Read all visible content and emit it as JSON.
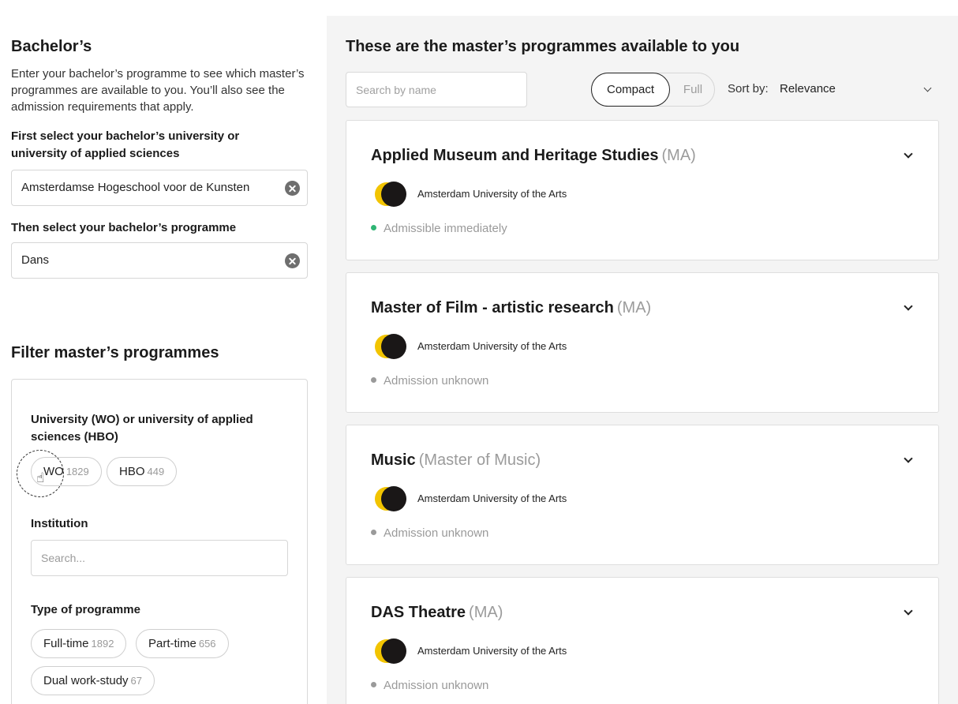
{
  "left": {
    "bachelor_heading": "Bachelor’s",
    "intro": "Enter your bachelor’s programme to see which master’s programmes are available to you. You’ll also see the admission requirements that apply.",
    "university_label": "First select your bachelor’s university or university of applied sciences",
    "university_value": "Amsterdamse Hogeschool voor de Kunsten",
    "programme_label": "Then select your bachelor’s programme",
    "programme_value": "Dans"
  },
  "filters": {
    "heading": "Filter master’s programmes",
    "level_label": "University (WO) or university of applied sciences (HBO)",
    "level_options": [
      {
        "label": "WO",
        "count": "1829"
      },
      {
        "label": "HBO",
        "count": "449"
      }
    ],
    "institution_label": "Institution",
    "institution_placeholder": "Search...",
    "type_label": "Type of programme",
    "type_options": [
      {
        "label": "Full-time",
        "count": "1892"
      },
      {
        "label": "Part-time",
        "count": "656"
      },
      {
        "label": "Dual work-study",
        "count": "67"
      }
    ]
  },
  "results": {
    "title": "These are the master’s programmes available to you",
    "search_placeholder": "Search by name",
    "view_compact": "Compact",
    "view_full": "Full",
    "view_selected": "Compact",
    "sort_label": "Sort by:",
    "sort_value": "Relevance",
    "programmes": [
      {
        "name": "Applied Museum and Heritage Studies",
        "type": "(MA)",
        "institution": "Amsterdam University of the Arts",
        "status": "Admissible immediately",
        "status_color": "#2fb574"
      },
      {
        "name": "Master of Film - artistic research",
        "type": "(MA)",
        "institution": "Amsterdam University of the Arts",
        "status": "Admission unknown",
        "status_color": "#9a9a9a"
      },
      {
        "name": "Music",
        "type": "(Master of Music)",
        "institution": "Amsterdam University of the Arts",
        "status": "Admission unknown",
        "status_color": "#9a9a9a"
      },
      {
        "name": "DAS Theatre",
        "type": "(MA)",
        "institution": "Amsterdam University of the Arts",
        "status": "Admission unknown",
        "status_color": "#9a9a9a"
      }
    ]
  },
  "icons": {
    "clear": "clear-circle-icon",
    "chevron": "chevron-down-icon",
    "cursor": "hand-pointer-icon",
    "logo": "institution-logo"
  },
  "colors": {
    "panel_bg": "#f4f4f4",
    "logo_yellow": "#f2c400",
    "logo_dark": "#1a1717"
  }
}
